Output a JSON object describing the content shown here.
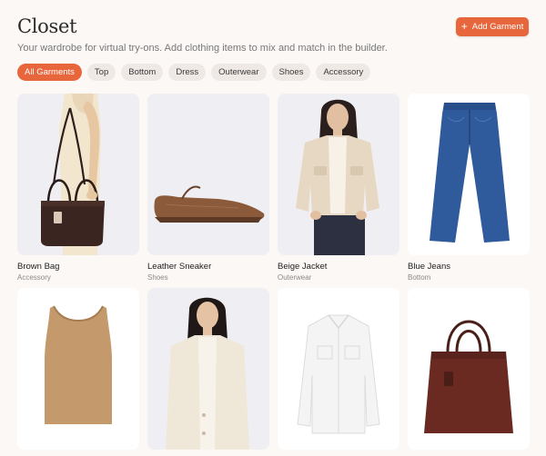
{
  "header": {
    "title": "Closet",
    "subtitle": "Your wardrobe for virtual try-ons. Add clothing items to mix and match in the builder.",
    "add_label": "Add Garment",
    "add_icon": "plus-icon",
    "accent_color": "#e8663c"
  },
  "filters": [
    {
      "label": "All Garments",
      "active": true
    },
    {
      "label": "Top",
      "active": false
    },
    {
      "label": "Bottom",
      "active": false
    },
    {
      "label": "Dress",
      "active": false
    },
    {
      "label": "Outerwear",
      "active": false
    },
    {
      "label": "Shoes",
      "active": false
    },
    {
      "label": "Accessory",
      "active": false
    }
  ],
  "garments": [
    {
      "name": "Brown Bag",
      "category": "Accessory"
    },
    {
      "name": "Leather Sneaker",
      "category": "Shoes"
    },
    {
      "name": "Beige Jacket",
      "category": "Outerwear"
    },
    {
      "name": "Blue Jeans",
      "category": "Bottom"
    },
    {
      "name": "",
      "category": ""
    },
    {
      "name": "",
      "category": ""
    },
    {
      "name": "",
      "category": ""
    },
    {
      "name": "",
      "category": ""
    }
  ]
}
